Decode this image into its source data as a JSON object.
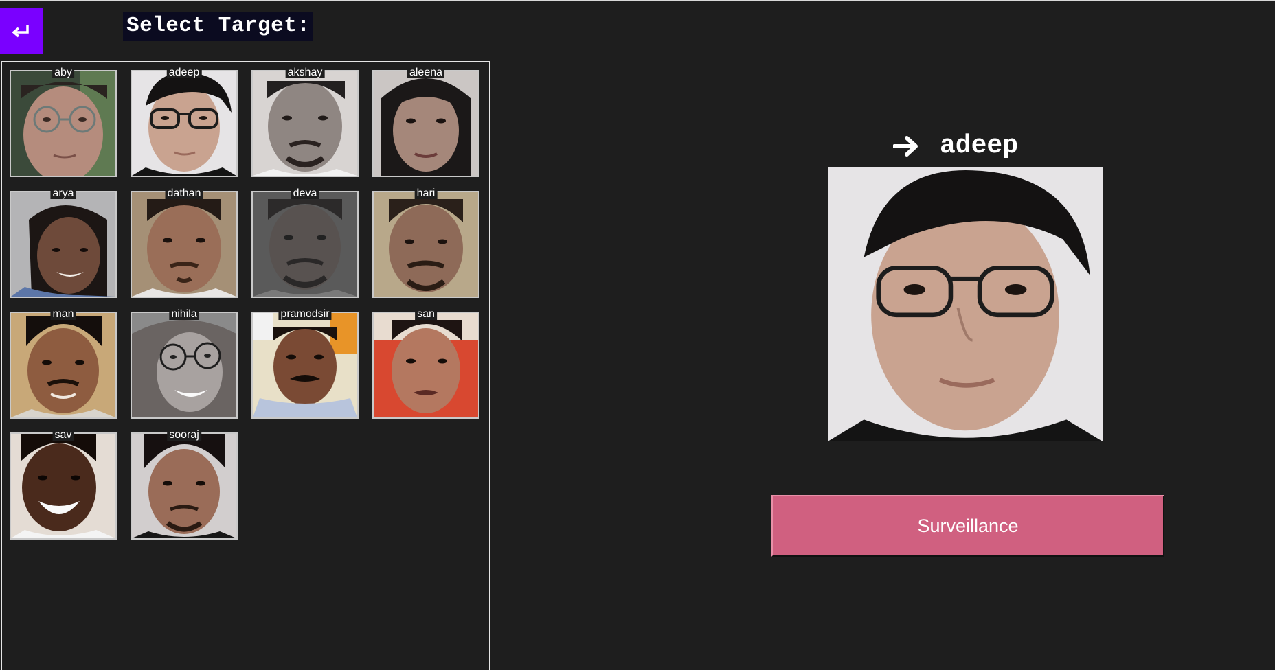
{
  "header": {
    "title": "Select Target:",
    "back_icon": "return-arrow-icon",
    "back_color": "#7a00ff"
  },
  "targets": [
    {
      "name": "aby"
    },
    {
      "name": "adeep"
    },
    {
      "name": "akshay"
    },
    {
      "name": "aleena"
    },
    {
      "name": "arya"
    },
    {
      "name": "dathan"
    },
    {
      "name": "deva"
    },
    {
      "name": "hari"
    },
    {
      "name": "man"
    },
    {
      "name": "nihila"
    },
    {
      "name": "pramodsir"
    },
    {
      "name": "san"
    },
    {
      "name": "sav"
    },
    {
      "name": "sooraj"
    }
  ],
  "preview": {
    "arrow_icon": "right-arrow-icon",
    "selected_name": "adeep"
  },
  "action": {
    "label": "Surveillance",
    "color": "#d06080"
  }
}
